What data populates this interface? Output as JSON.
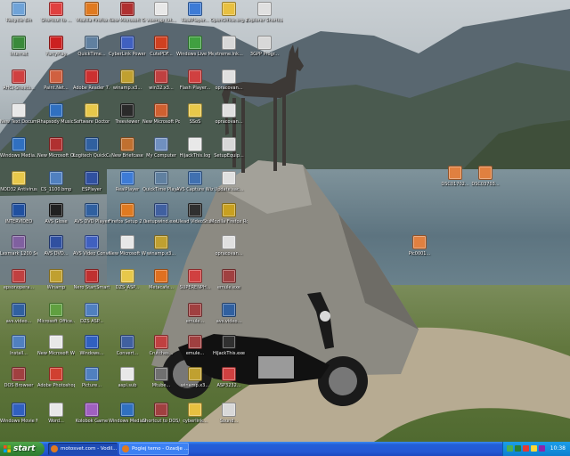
{
  "taskbar": {
    "start_label": "start",
    "tasks": [
      {
        "label": "motosvet.com - Vodil..."
      },
      {
        "label": "Poglej temo - Ozadje ..."
      }
    ],
    "clock": "10:38"
  },
  "desktop_icons": [
    {
      "label": "Recycle Bin",
      "icon": "recycle-bin-icon",
      "color": "#6fa3d8"
    },
    {
      "label": "Shortcut to ...",
      "icon": "shortcut-icon",
      "color": "#e04040"
    },
    {
      "label": "Mozilla Firefox",
      "icon": "firefox-icon",
      "color": "#e07a20"
    },
    {
      "label": "New Microsoft Office Acc...",
      "icon": "access-icon",
      "color": "#b03030"
    },
    {
      "label": "voxmap.txt...",
      "icon": "text-file-icon",
      "color": "#e8e8e8"
    },
    {
      "label": "RealPlayer...",
      "icon": "realplayer-icon",
      "color": "#3d7bd6"
    },
    {
      "label": "OpenOffice.org 2.0...",
      "icon": "openoffice-icon",
      "color": "#e8c040"
    },
    {
      "label": "Explorer Shortcut",
      "icon": "explorer-icon",
      "color": "#e0e0e0"
    },
    {
      "label": "Internet",
      "icon": "internet-icon",
      "color": "#3a8a3a"
    },
    {
      "label": "PartyPlay",
      "icon": "partyplay-icon",
      "color": "#cc2020"
    },
    {
      "label": "QuickTime...",
      "icon": "quicktime-icon",
      "color": "#6080a0"
    },
    {
      "label": "CyberLink PowerDVD",
      "icon": "powerdvd-icon",
      "color": "#4060c0"
    },
    {
      "label": "CutePDF...",
      "icon": "pdf-icon",
      "color": "#d04020"
    },
    {
      "label": "Windows Live Messenger",
      "icon": "messenger-icon",
      "color": "#40a040"
    },
    {
      "label": "xtreme.lnk...",
      "icon": "shortcut-icon",
      "color": "#d8d8d8"
    },
    {
      "label": "3GPP Progr...",
      "icon": "program-icon",
      "color": "#d8d8d8"
    },
    {
      "label": "AHCI-Sheets...",
      "icon": "sheets-icon",
      "color": "#d04040"
    },
    {
      "label": "Paint.Net...",
      "icon": "paint-icon",
      "color": "#d06040"
    },
    {
      "label": "Adobe Reader 7.0",
      "icon": "acrobat-icon",
      "color": "#cc3030"
    },
    {
      "label": "winamp.x3...",
      "icon": "winamp-icon",
      "color": "#c0a030"
    },
    {
      "label": "win32.x3...",
      "icon": "program-icon",
      "color": "#c04040"
    },
    {
      "label": "Flash Player...",
      "icon": "flash-icon",
      "color": "#d04040"
    },
    {
      "label": "opracovan...",
      "icon": "text-file-icon",
      "color": "#e0e0e0"
    },
    {
      "label": "New Text Document",
      "icon": "text-file-icon",
      "color": "#e8e8e8"
    },
    {
      "label": "Rhapsody Music Manag...",
      "icon": "rhapsody-icon",
      "color": "#3070c0"
    },
    {
      "label": "Software Doctor",
      "icon": "folder-icon",
      "color": "#e8c84a"
    },
    {
      "label": "Treeviewer",
      "icon": "tree-icon",
      "color": "#2a2a2a"
    },
    {
      "label": "New Microsoft PowerPoint...",
      "icon": "powerpoint-icon",
      "color": "#d06030"
    },
    {
      "label": "SSoS",
      "icon": "folder-icon",
      "color": "#e8c84a"
    },
    {
      "label": "opracovan...",
      "icon": "text-file-icon",
      "color": "#e0e0e0"
    },
    {
      "label": "Windows Media...",
      "icon": "media-player-icon",
      "color": "#3070c0"
    },
    {
      "label": "New Microsoft Office Access",
      "icon": "access-icon",
      "color": "#b03030"
    },
    {
      "label": "Logitech QuickCam...",
      "icon": "webcam-icon",
      "color": "#3060a0"
    },
    {
      "label": "New Briefcase",
      "icon": "briefcase-icon",
      "color": "#c07030"
    },
    {
      "label": "My Computer",
      "icon": "my-computer-icon",
      "color": "#7090c0"
    },
    {
      "label": "HijackThis.log",
      "icon": "text-file-icon",
      "color": "#e8e8e8"
    },
    {
      "label": "SetupEquip...",
      "icon": "setup-icon",
      "color": "#d8d8d8"
    },
    {
      "label": "NOD32 Antivirus",
      "icon": "folder-icon",
      "color": "#e8c84a"
    },
    {
      "label": "CS_1100.bmp",
      "icon": "image-icon",
      "color": "#5080c0"
    },
    {
      "label": "ESPlayer",
      "icon": "esplayer-icon",
      "color": "#3050a0"
    },
    {
      "label": "RealPlayer",
      "icon": "realplayer-icon",
      "color": "#3d7bd6"
    },
    {
      "label": "QuickTime Player",
      "icon": "quicktime-icon",
      "color": "#6080a0"
    },
    {
      "label": "AVS Capture Wizard",
      "icon": "capture-icon",
      "color": "#4070b0"
    },
    {
      "label": "Update.sac...",
      "icon": "text-file-icon",
      "color": "#e0e0e0"
    },
    {
      "label": "INTERVIDEO",
      "icon": "intervideo-icon",
      "color": "#2050a0"
    },
    {
      "label": "AVS Glose",
      "icon": "avs-icon",
      "color": "#202020"
    },
    {
      "label": "AVS DVD Player",
      "icon": "dvd-icon",
      "color": "#3060a0"
    },
    {
      "label": "Firefox Setup 2.0.exe",
      "icon": "firefox-icon",
      "color": "#e07a20"
    },
    {
      "label": "setupwind.exe",
      "icon": "setup-icon",
      "color": "#4060a0"
    },
    {
      "label": "Ulead VideoStudio",
      "icon": "ulead-icon",
      "color": "#303030"
    },
    {
      "label": "Mozilla Firefox Rosado",
      "icon": "archive-icon",
      "color": "#c8a020"
    },
    {
      "label": "Lexmark 1200 Series...",
      "icon": "printer-icon",
      "color": "#8060a0"
    },
    {
      "label": "AVS DVD...",
      "icon": "avs-icon",
      "color": "#3050a0"
    },
    {
      "label": "AVS Video Converter",
      "icon": "video-icon",
      "color": "#4060c0"
    },
    {
      "label": "New Microsoft Word Docum...",
      "icon": "word-icon",
      "color": "#e8e8e8"
    },
    {
      "label": "winamp.x3...",
      "icon": "winamp-icon",
      "color": "#c0a030"
    },
    {
      "label": "opracovan...",
      "icon": "text-file-icon",
      "color": "#e0e0e0"
    },
    {
      "label": "epsonopera...",
      "icon": "epson-icon",
      "color": "#c04040"
    },
    {
      "label": "Winamp",
      "icon": "winamp-icon",
      "color": "#c0a030"
    },
    {
      "label": "Nero StartSmart",
      "icon": "nero-icon",
      "color": "#c03030"
    },
    {
      "label": "DZS_ASP...",
      "icon": "folder-icon",
      "color": "#e8c84a"
    },
    {
      "label": "Metacafe...",
      "icon": "metacafe-icon",
      "color": "#e07020"
    },
    {
      "label": "SUPERENPH...",
      "icon": "superenph-icon",
      "color": "#d04040"
    },
    {
      "label": "emule.exe",
      "icon": "emule-icon",
      "color": "#a04040"
    },
    {
      "label": "avs.video...",
      "icon": "video-icon",
      "color": "#3060a0"
    },
    {
      "label": "Microsoft Office...",
      "icon": "office-icon",
      "color": "#60a040"
    },
    {
      "label": "DZS ASP...",
      "icon": "program-icon",
      "color": "#5080c0"
    },
    {
      "label": "emule...",
      "icon": "emule-icon",
      "color": "#a04040"
    },
    {
      "label": "avs.video...",
      "icon": "video-icon",
      "color": "#3060a0"
    },
    {
      "label": "Install...",
      "icon": "install-icon",
      "color": "#5080c0"
    },
    {
      "label": "New Microsoft Word Docum...",
      "icon": "word-icon",
      "color": "#e8e8e8"
    },
    {
      "label": "Windows...",
      "icon": "windows-icon",
      "color": "#3060c0"
    },
    {
      "label": "Convert...",
      "icon": "convert-icon",
      "color": "#4060a0"
    },
    {
      "label": "Crutches...",
      "icon": "program-icon",
      "color": "#c04040"
    },
    {
      "label": "emule...",
      "icon": "emule-icon",
      "color": "#a04040"
    },
    {
      "label": "HiJackThis.exe",
      "icon": "hijackthis-icon",
      "color": "#303030"
    },
    {
      "label": "DOS Browser",
      "icon": "dos-icon",
      "color": "#a04040"
    },
    {
      "label": "Adobe Photoshop...",
      "icon": "photoshop-icon",
      "color": "#d04030"
    },
    {
      "label": "Picture...",
      "icon": "picture-icon",
      "color": "#5080c0"
    },
    {
      "label": "aspi.sub",
      "icon": "text-file-icon",
      "color": "#e8e8e8"
    },
    {
      "label": "Mtube...",
      "icon": "mtube-icon",
      "color": "#707070"
    },
    {
      "label": "winamp.x3...",
      "icon": "winamp-icon",
      "color": "#c0a030"
    },
    {
      "label": "ASP3232...",
      "icon": "program-icon",
      "color": "#d04040"
    },
    {
      "label": "Windows Movie Maker",
      "icon": "movie-maker-icon",
      "color": "#3060c0"
    },
    {
      "label": "Word...",
      "icon": "word-icon",
      "color": "#e8e8e8"
    },
    {
      "label": "Kolobok Game",
      "icon": "game-icon",
      "color": "#a060c0"
    },
    {
      "label": "Windows Media Player",
      "icon": "media-player-icon",
      "color": "#3070c0"
    },
    {
      "label": "Shortcut to DOS/Games",
      "icon": "dos-icon",
      "color": "#a04040"
    },
    {
      "label": "cyberlink...",
      "icon": "cyberlink-icon",
      "color": "#e8c040"
    },
    {
      "label": "Sound...",
      "icon": "sound-icon",
      "color": "#d8d8d8"
    },
    {
      "label": "DSC01702...",
      "icon": "image-icon",
      "color": "#e08040"
    },
    {
      "label": "DSC03703...",
      "icon": "image-icon",
      "color": "#e08040"
    },
    {
      "label": "Pic0001...",
      "icon": "image-icon",
      "color": "#e08040"
    }
  ]
}
